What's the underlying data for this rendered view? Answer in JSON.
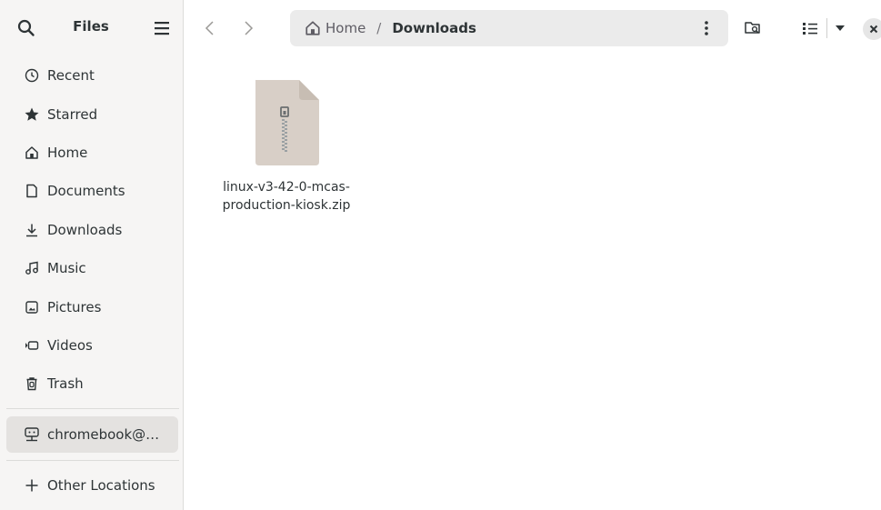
{
  "sidebar": {
    "title": "Files",
    "search_icon": "search-icon",
    "menu_icon": "hamburger-menu-icon",
    "items": [
      {
        "label": "Recent",
        "icon": "clock-icon"
      },
      {
        "label": "Starred",
        "icon": "star-icon"
      },
      {
        "label": "Home",
        "icon": "home-icon"
      },
      {
        "label": "Documents",
        "icon": "document-icon"
      },
      {
        "label": "Downloads",
        "icon": "download-icon"
      },
      {
        "label": "Music",
        "icon": "music-icon"
      },
      {
        "label": "Pictures",
        "icon": "picture-icon"
      },
      {
        "label": "Videos",
        "icon": "video-icon"
      },
      {
        "label": "Trash",
        "icon": "trash-icon"
      }
    ],
    "device": {
      "label": "chromebook@…",
      "icon": "network-drive-icon"
    },
    "other": {
      "label": "Other Locations",
      "icon": "plus-icon"
    }
  },
  "header": {
    "breadcrumb": {
      "home": "Home",
      "separator": "/",
      "current": "Downloads"
    }
  },
  "files": [
    {
      "name": "linux-v3-42-0-mcas-production-kiosk.zip",
      "icon": "zip-archive-icon"
    }
  ],
  "colors": {
    "sidebar_bg": "#f6f5f4",
    "selected_bg": "#e4e2e0",
    "pathbar_bg": "#ebebeb",
    "file_icon": "#d8cfc7"
  }
}
